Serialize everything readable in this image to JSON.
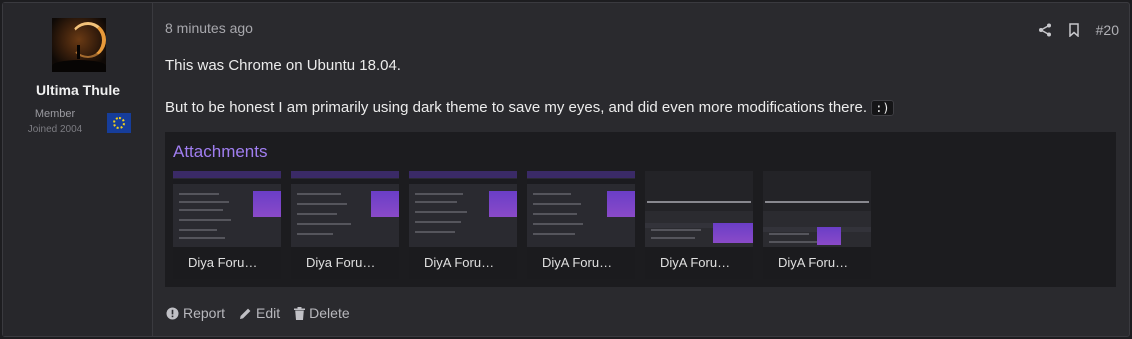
{
  "user": {
    "name": "Ultima Thule",
    "role": "Member",
    "joined": "Joined 2004",
    "avatar_icon": "avatar-eclipse",
    "flag_icon": "eu-flag-icon"
  },
  "post": {
    "timestamp": "8 minutes ago",
    "number": "#20",
    "paragraphs": {
      "p1": "This was Chrome on Ubuntu 18.04.",
      "p2": "But to be honest I am primarily using dark theme to save my eyes, and did even more modifications there. ",
      "emoticon": ":)"
    }
  },
  "attachments": {
    "title": "Attachments",
    "items": [
      {
        "caption": "Diya Foru…"
      },
      {
        "caption": "Diya Foru…"
      },
      {
        "caption": "DiyA Foru…"
      },
      {
        "caption": "DiyA Foru…"
      },
      {
        "caption": "DiyA Foru…"
      },
      {
        "caption": "DiyA Foru…"
      }
    ]
  },
  "footer": {
    "report": "Report",
    "edit": "Edit",
    "delete": "Delete"
  },
  "colors": {
    "accent": "#a07ef0",
    "background": "#2a2a2e"
  }
}
